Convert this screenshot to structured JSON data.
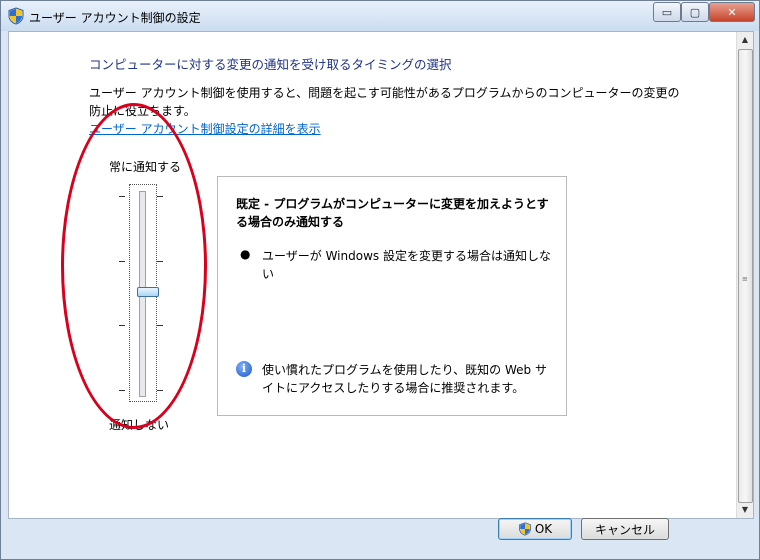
{
  "window": {
    "title": "ユーザー アカウント制御の設定",
    "minimize": "▭",
    "maximize": "▢",
    "close": "✕"
  },
  "main": {
    "heading": "コンピューターに対する変更の通知を受け取るタイミングの選択",
    "description": "ユーザー アカウント制御を使用すると、問題を起こす可能性があるプログラムからのコンピューターの変更の防止に役立ちます。",
    "link": "ユーザー アカウント制御設定の詳細を表示"
  },
  "slider": {
    "top_label": "常に通知する",
    "bottom_label": "通知しない",
    "levels": 4,
    "selected_level": 3
  },
  "info": {
    "title": "既定 - プログラムがコンピューターに変更を加えようとする場合のみ通知する",
    "bullet": "ユーザーが Windows 設定を変更する場合は通知しない",
    "note": "使い慣れたプログラムを使用したり、既知の Web サイトにアクセスしたりする場合に推奨されます。"
  },
  "buttons": {
    "ok": "OK",
    "cancel": "キャンセル"
  },
  "colors": {
    "heading": "#1e3287",
    "link": "#0066cc",
    "annotation": "#d8001c"
  }
}
